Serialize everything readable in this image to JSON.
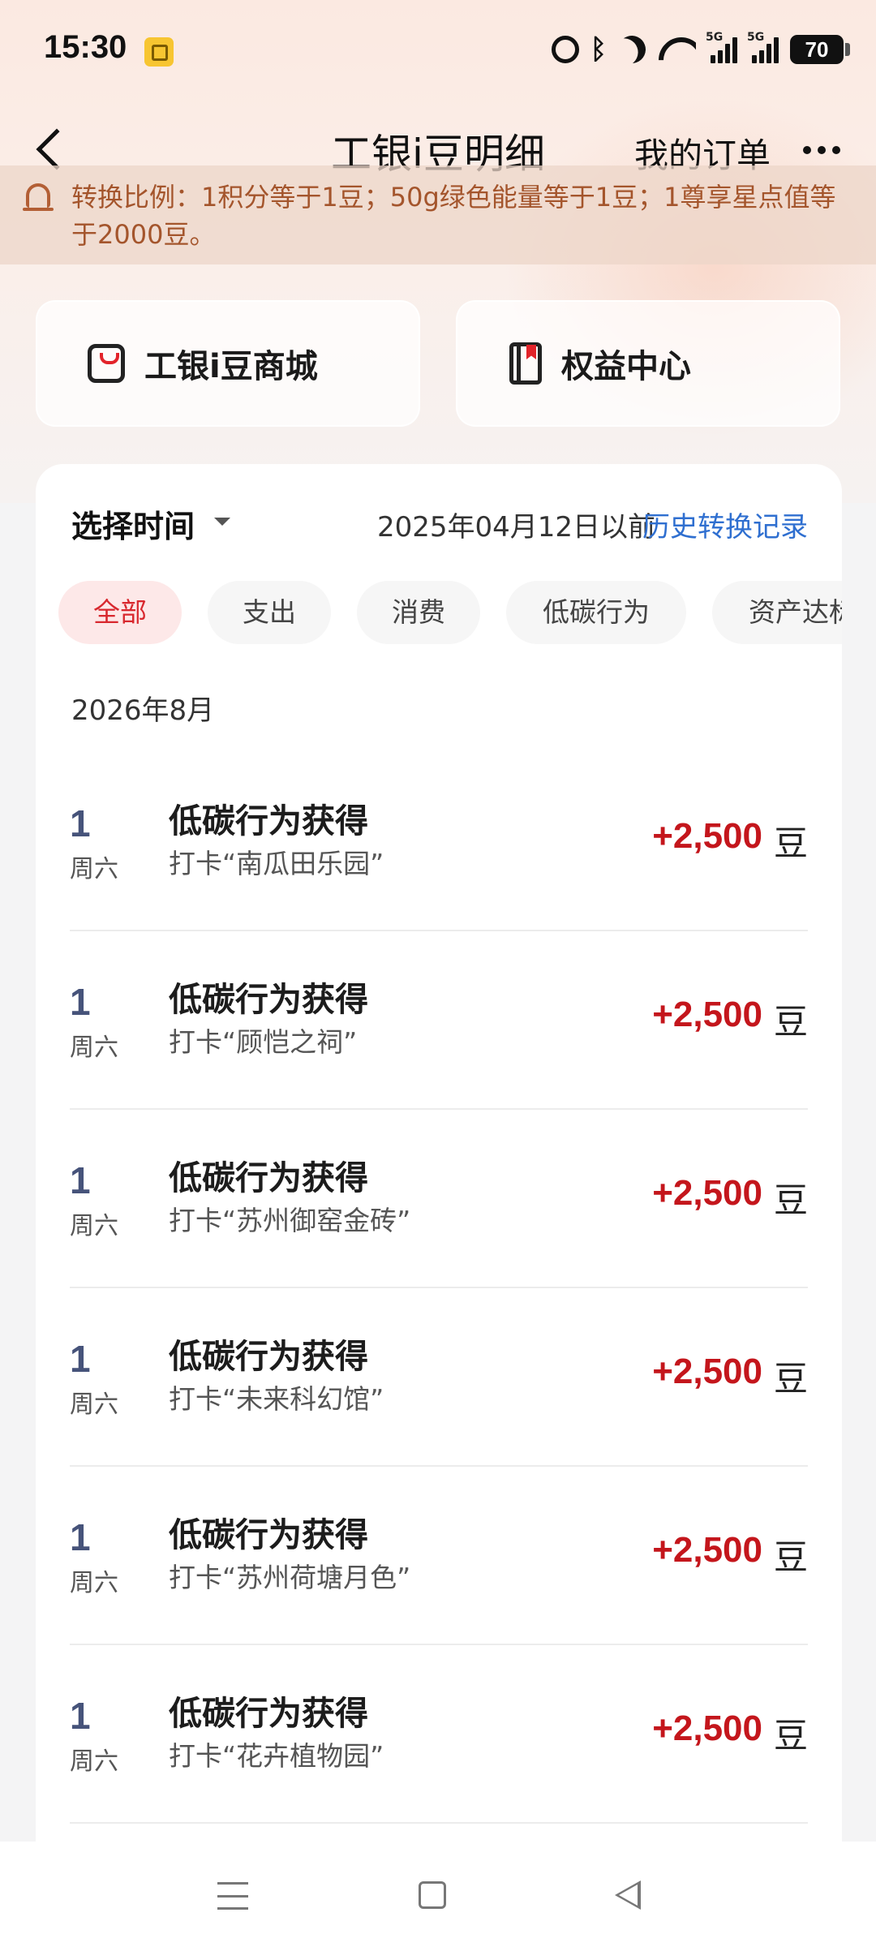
{
  "status_bar": {
    "time": "15:30",
    "signal_tag_1": "5G",
    "signal_tag_2": "5G",
    "battery": "70"
  },
  "header": {
    "title": "工银i豆明细",
    "orders_link": "我的订单"
  },
  "notice": {
    "text": "转换比例：1积分等于1豆；50g绿色能量等于1豆；1尊享星点值等于2000豆。"
  },
  "entries": {
    "mall": "工银i豆商城",
    "rights": "权益中心"
  },
  "filter": {
    "time_select": "选择时间",
    "date_before": "2025年04月12日以前",
    "history_link": "历史转换记录",
    "chips": [
      "全部",
      "支出",
      "消费",
      "低碳行为",
      "资产达标"
    ]
  },
  "month": "2026年8月",
  "records": [
    {
      "day": "1",
      "weekday": "周六",
      "title": "低碳行为获得",
      "subtitle": "打卡“南瓜田乐园”",
      "amount": "+2,500",
      "unit": "豆"
    },
    {
      "day": "1",
      "weekday": "周六",
      "title": "低碳行为获得",
      "subtitle": "打卡“顾恺之祠”",
      "amount": "+2,500",
      "unit": "豆"
    },
    {
      "day": "1",
      "weekday": "周六",
      "title": "低碳行为获得",
      "subtitle": "打卡“苏州御窑金砖”",
      "amount": "+2,500",
      "unit": "豆"
    },
    {
      "day": "1",
      "weekday": "周六",
      "title": "低碳行为获得",
      "subtitle": "打卡“未来科幻馆”",
      "amount": "+2,500",
      "unit": "豆"
    },
    {
      "day": "1",
      "weekday": "周六",
      "title": "低碳行为获得",
      "subtitle": "打卡“苏州荷塘月色”",
      "amount": "+2,500",
      "unit": "豆"
    },
    {
      "day": "1",
      "weekday": "周六",
      "title": "低碳行为获得",
      "subtitle": "打卡“花卉植物园”",
      "amount": "+2,500",
      "unit": "豆"
    }
  ],
  "colors": {
    "accent_red": "#c4161c",
    "link_blue": "#2f6fd0",
    "notice_text": "#a4552c"
  }
}
